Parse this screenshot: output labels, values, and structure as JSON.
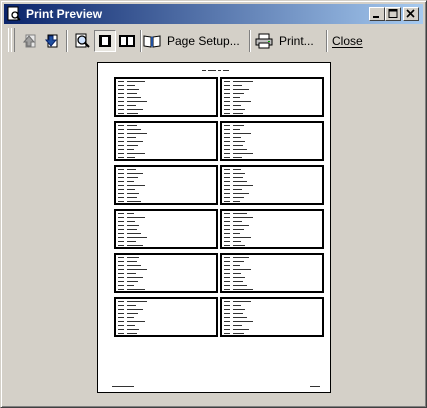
{
  "window": {
    "title": "Print Preview",
    "icon": "print-preview-icon"
  },
  "caption_buttons": {
    "minimize": "_",
    "maximize": "□",
    "close": "×"
  },
  "toolbar": {
    "page_setup_label": "Page Setup...",
    "print_label": "Print...",
    "close_label": "Close",
    "icons": [
      "previous-page-icon",
      "next-page-icon",
      "zoom-icon",
      "one-page-icon",
      "two-pages-icon",
      "book-icon",
      "printer-icon"
    ]
  },
  "preview": {
    "rows": 6,
    "columns": 2
  }
}
